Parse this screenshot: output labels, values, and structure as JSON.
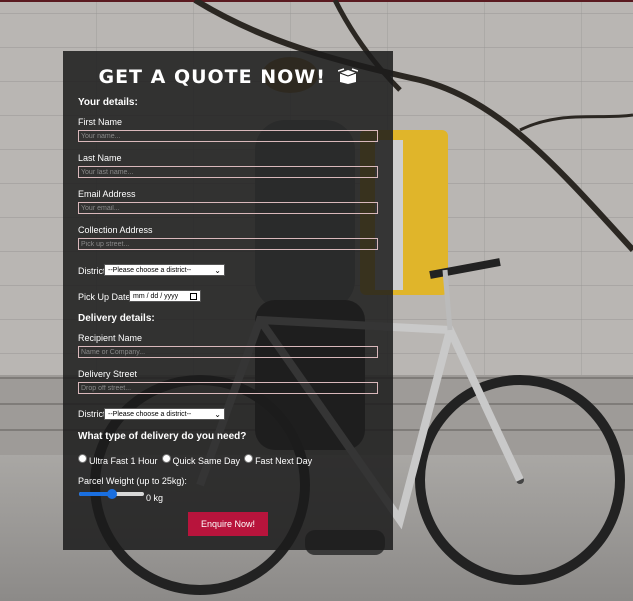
{
  "form": {
    "title": "GET A QUOTE NOW!",
    "your_details": "Your details:",
    "first_name_label": "First Name",
    "first_name_placeholder": "Your name...",
    "last_name_label": "Last Name",
    "last_name_placeholder": "Your last name...",
    "email_label": "Email Address",
    "email_placeholder": "Your email...",
    "collection_label": "Collection Address",
    "collection_placeholder": "Pick up street...",
    "district_label": "District",
    "district_select": "--Please choose a district--",
    "pickup_date_label": "Pick Up Date:",
    "pickup_date_value": "mm / dd / yyyy",
    "delivery_details": "Delivery details:",
    "recipient_label": "Recipient Name",
    "recipient_placeholder": "Name or Company...",
    "delivery_street_label": "Delivery Street",
    "delivery_street_placeholder": "Drop off street...",
    "delivery_district_label": "District",
    "delivery_district_select": "--Please choose a district--",
    "delivery_type_question": "What type of delivery do you need?",
    "delivery_options": [
      "Ultra Fast 1 Hour",
      "Quick Same Day",
      "Fast Next Day"
    ],
    "weight_label": "Parcel Weight (up to 25kg):",
    "weight_value": "0 kg",
    "weight_slider_fraction": 0.5,
    "enquire_button": "Enquire Now!"
  },
  "colors": {
    "panel": "#1c1c1c",
    "field_border": "#d9b8bb",
    "button": "#b8143c",
    "slider": "#1a6fe0"
  },
  "icons": {
    "title_icon": "open-box-icon",
    "select_chevron": "chevron-down-icon",
    "date_calendar": "calendar-icon"
  }
}
